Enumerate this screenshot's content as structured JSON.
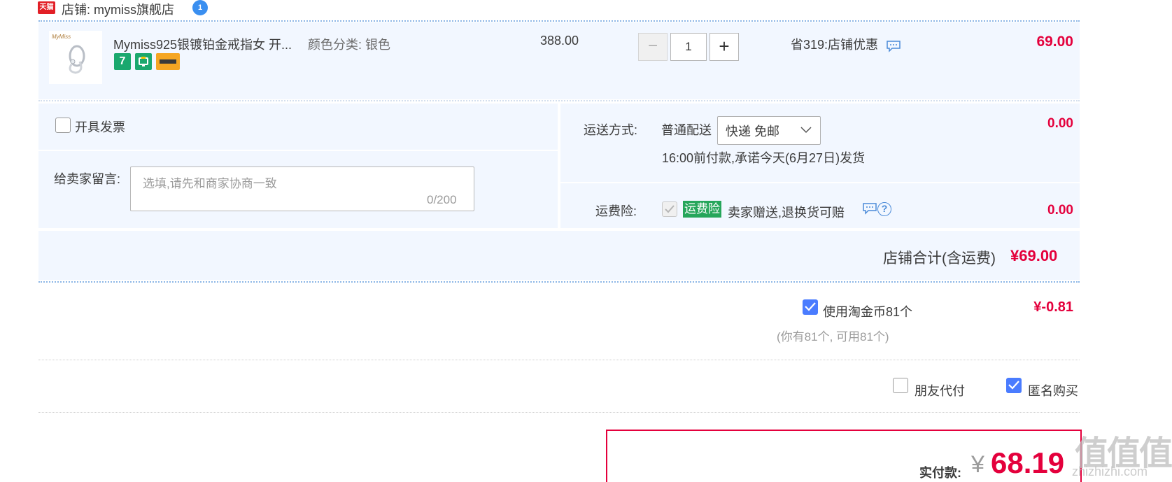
{
  "shop": {
    "badge": "天猫",
    "label": "店铺: mymiss旗舰店",
    "ww_badge": "1"
  },
  "item": {
    "thumb_brand": "MyMiss",
    "title": "Mymiss925银镀铂金戒指女 开...",
    "sku": "颜色分类: 银色",
    "service_icons": [
      "7",
      "guarantee-icon",
      "card-icon"
    ],
    "service_seven": "7",
    "unit_price": "388.00",
    "qty_minus": "−",
    "quantity": "1",
    "qty_plus": "+",
    "discount": "省319:店铺优惠",
    "total": "69.00"
  },
  "options": {
    "invoice_label": "开具发票",
    "message_label": "给卖家留言:",
    "message_placeholder": "选填,请先和商家协商一致",
    "message_count": "0/200",
    "shipping_label": "运送方式:",
    "shipping_type": "普通配送",
    "shipping_select": "快递 免邮",
    "shipping_note": "16:00前付款,承诺今天(6月27日)发货",
    "shipping_cost": "0.00",
    "insurance_label": "运费险:",
    "insurance_badge": "运费险",
    "insurance_text": "卖家赠送,退换货可赔",
    "insurance_help": "?",
    "insurance_cost": "0.00"
  },
  "subtotal": {
    "label": "店铺合计(含运费)",
    "value": "¥69.00"
  },
  "coins": {
    "label": "使用淘金币81个",
    "note": "(你有81个, 可用81个)",
    "value": "¥-0.81",
    "checked": true
  },
  "extras": {
    "friend_pay_label": "朋友代付",
    "friend_pay_checked": false,
    "anonymous_label": "匿名购买",
    "anonymous_checked": true
  },
  "payment": {
    "label": "实付款:",
    "currency": "¥",
    "amount": "68.19"
  },
  "watermark": {
    "logo": "值值值",
    "site": "zhizhizhi.com"
  },
  "colors": {
    "accent_red": "#e4003c",
    "panel_blue": "#f2f7ff",
    "check_blue": "#4a7cff",
    "insurance_green": "#26a65b"
  }
}
